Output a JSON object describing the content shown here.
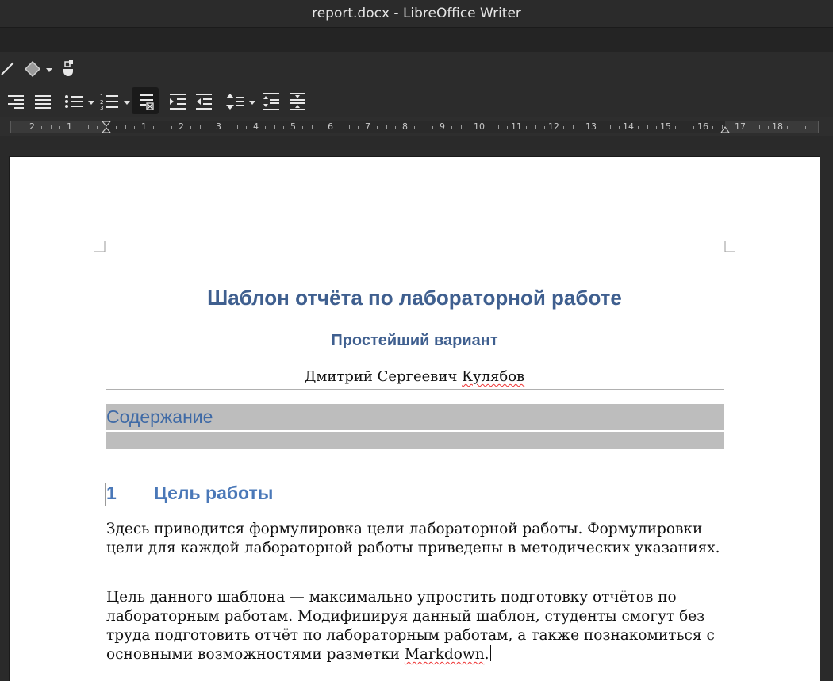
{
  "window": {
    "title": "report.docx - LibreOffice Writer"
  },
  "toolbar1": {
    "icons": [
      "line-icon",
      "shapes-icon",
      "chevron-down-icon",
      "insert-object-icon"
    ]
  },
  "toolbar2": {
    "icons": [
      "align-right-icon",
      "justify-icon",
      "unordered-list-icon",
      "ordered-list-icon",
      "no-list-icon",
      "increase-indent-icon",
      "decrease-indent-icon",
      "line-spacing-icon",
      "increase-paragraph-spacing-icon",
      "decrease-paragraph-spacing-icon"
    ]
  },
  "ruler": {
    "labels": [
      "2",
      "1",
      "1",
      "2",
      "3",
      "4",
      "5",
      "6",
      "7",
      "8",
      "9",
      "10",
      "11",
      "12",
      "13",
      "14",
      "15",
      "16",
      "17",
      "18"
    ]
  },
  "document": {
    "title": "Шаблон отчёта по лабораторной работе",
    "subtitle": "Простейший вариант",
    "author_first": "Дмитрий Сергеевич ",
    "author_last": "Кулябов",
    "toc_heading": "Содержание",
    "section1": {
      "number": "1",
      "title": "Цель работы"
    },
    "paragraph1": "Здесь приводится формулировка цели лабораторной работы. Формулировки цели для каждой лабораторной работы приведены в методических указаниях.",
    "paragraph2_text": "Цель данного шаблона — максимально упростить подготовку отчётов по лабораторным работам. Модифицируя данный шаблон, студенты смогут без труда подготовить отчёт по лабораторным работам, а также познакомиться с основными возможностями разметки ",
    "paragraph2_word": "Markdown",
    "paragraph2_end": "."
  },
  "colors": {
    "heading": "#3f5f8f",
    "heading1": "#4a78b8",
    "toc_bg": "#bdbdbd",
    "spell_underline": "#e33"
  }
}
